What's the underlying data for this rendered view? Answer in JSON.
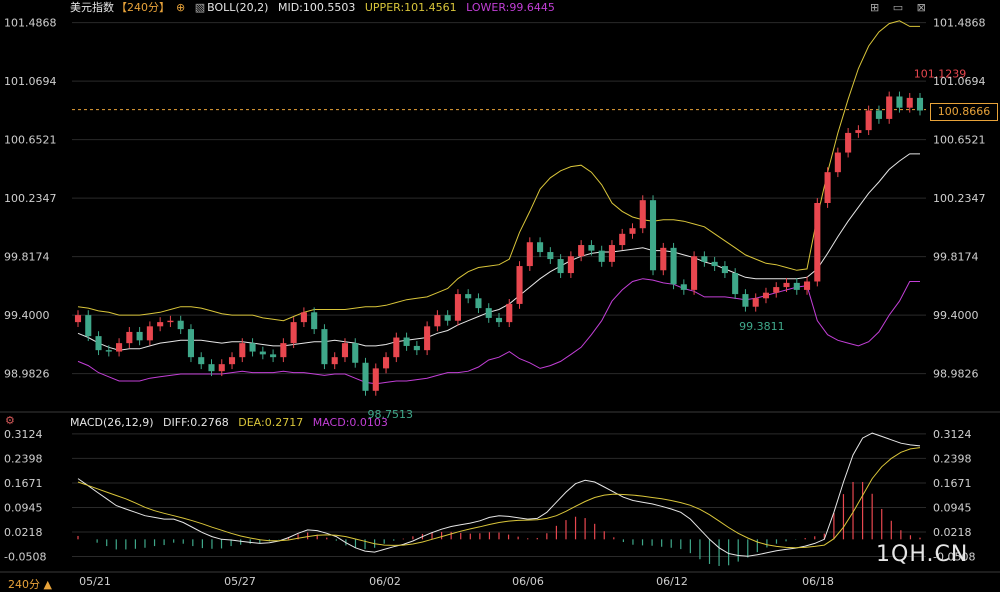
{
  "header": {
    "title": "美元指数",
    "period_label": "【240分】",
    "bull_label": "BOLL(20,2)",
    "mid": "MID:100.5503",
    "upper": "UPPER:101.4561",
    "lower": "LOWER:99.6445"
  },
  "macd_header": {
    "label": "MACD(26,12,9)",
    "diff": "DIFF:0.2768",
    "dea": "DEA:0.2717",
    "macd": "MACD:0.0103"
  },
  "current_price_tag": "100.8666",
  "period_button": "240分",
  "watermark": "1QH.CN",
  "colors": {
    "up": "#e8474f",
    "down": "#3fa88a",
    "mid": "#e6e6e6",
    "upper": "#d9c53a",
    "lower": "#c23fd6",
    "diff": "#e6e6e6",
    "dea": "#d9c53a",
    "grid": "#2a2a2a",
    "axis": "#cfcfcf"
  },
  "chart_data": [
    {
      "type": "candlestick",
      "title": "美元指数 240分",
      "y_ticks": [
        "101.4868",
        "101.0694",
        "100.6521",
        "100.2347",
        "99.8174",
        "99.4000",
        "98.9826"
      ],
      "y_tick_values": [
        101.4868,
        101.0694,
        100.6521,
        100.2347,
        99.8174,
        99.4,
        98.9826
      ],
      "x_ticks": [
        "05/21",
        "05/27",
        "06/02",
        "06/06",
        "06/12",
        "06/18"
      ],
      "annotations": [
        "101.1239",
        "98.7513",
        "99.3811"
      ],
      "last_price": 100.8666,
      "ylim": [
        98.83,
        101.52
      ],
      "candles_close": [
        99.4,
        99.25,
        99.15,
        99.14,
        99.2,
        99.28,
        99.22,
        99.32,
        99.35,
        99.36,
        99.3,
        99.1,
        99.05,
        99.0,
        99.05,
        99.1,
        99.2,
        99.14,
        99.12,
        99.1,
        99.2,
        99.35,
        99.42,
        99.3,
        99.05,
        99.1,
        99.2,
        99.06,
        98.86,
        99.02,
        99.1,
        99.24,
        99.18,
        99.15,
        99.32,
        99.4,
        99.36,
        99.55,
        99.52,
        99.45,
        99.38,
        99.35,
        99.48,
        99.75,
        99.92,
        99.85,
        99.8,
        99.7,
        99.82,
        99.9,
        99.86,
        99.78,
        99.9,
        99.98,
        100.02,
        100.22,
        99.72,
        99.88,
        99.62,
        99.58,
        99.82,
        99.78,
        99.75,
        99.7,
        99.55,
        99.46,
        99.52,
        99.56,
        99.6,
        99.63,
        99.58,
        99.64,
        100.2,
        100.42,
        100.56,
        100.7,
        100.72,
        100.86,
        100.8,
        100.96,
        100.88,
        100.95,
        100.86
      ],
      "mid_band": [
        99.27,
        99.24,
        99.2,
        99.17,
        99.15,
        99.16,
        99.16,
        99.18,
        99.2,
        99.21,
        99.22,
        99.22,
        99.22,
        99.21,
        99.2,
        99.21,
        99.21,
        99.2,
        99.19,
        99.18,
        99.18,
        99.19,
        99.2,
        99.21,
        99.21,
        99.22,
        99.21,
        99.2,
        99.18,
        99.18,
        99.19,
        99.21,
        99.22,
        99.23,
        99.24,
        99.27,
        99.29,
        99.33,
        99.36,
        99.39,
        99.42,
        99.44,
        99.48,
        99.54,
        99.6,
        99.66,
        99.71,
        99.75,
        99.79,
        99.82,
        99.84,
        99.85,
        99.85,
        99.86,
        99.87,
        99.88,
        99.86,
        99.86,
        99.85,
        99.83,
        99.81,
        99.78,
        99.76,
        99.73,
        99.7,
        99.67,
        99.66,
        99.66,
        99.66,
        99.66,
        99.66,
        99.67,
        99.73,
        99.84,
        99.96,
        100.07,
        100.17,
        100.27,
        100.35,
        100.44,
        100.5,
        100.55,
        100.55
      ],
      "upper_band": [
        99.46,
        99.45,
        99.43,
        99.42,
        99.4,
        99.4,
        99.4,
        99.41,
        99.42,
        99.44,
        99.46,
        99.46,
        99.45,
        99.43,
        99.41,
        99.4,
        99.4,
        99.4,
        99.38,
        99.37,
        99.36,
        99.39,
        99.42,
        99.44,
        99.44,
        99.44,
        99.44,
        99.45,
        99.46,
        99.46,
        99.47,
        99.49,
        99.51,
        99.52,
        99.53,
        99.56,
        99.59,
        99.66,
        99.71,
        99.74,
        99.75,
        99.76,
        99.8,
        99.99,
        100.14,
        100.3,
        100.38,
        100.43,
        100.46,
        100.47,
        100.42,
        100.33,
        100.2,
        100.14,
        100.1,
        100.08,
        100.07,
        100.08,
        100.08,
        100.07,
        100.05,
        100.03,
        99.98,
        99.93,
        99.88,
        99.83,
        99.8,
        99.77,
        99.76,
        99.74,
        99.72,
        99.73,
        100.1,
        100.42,
        100.7,
        100.94,
        101.16,
        101.32,
        101.42,
        101.48,
        101.5,
        101.46,
        101.46
      ],
      "lower_band": [
        99.07,
        99.04,
        98.99,
        98.96,
        98.93,
        98.93,
        98.93,
        98.95,
        98.96,
        98.97,
        98.98,
        98.98,
        98.98,
        98.98,
        98.98,
        98.99,
        99.0,
        98.99,
        98.99,
        98.99,
        99.0,
        98.99,
        98.99,
        98.98,
        98.97,
        98.98,
        98.98,
        98.95,
        98.92,
        98.91,
        98.92,
        98.93,
        98.93,
        98.94,
        98.95,
        98.97,
        98.99,
        98.99,
        99.0,
        99.03,
        99.08,
        99.1,
        99.14,
        99.09,
        99.06,
        99.02,
        99.04,
        99.07,
        99.12,
        99.17,
        99.26,
        99.36,
        99.5,
        99.58,
        99.64,
        99.66,
        99.65,
        99.63,
        99.62,
        99.59,
        99.57,
        99.53,
        99.53,
        99.53,
        99.52,
        99.51,
        99.52,
        99.54,
        99.56,
        99.58,
        99.6,
        99.61,
        99.36,
        99.26,
        99.22,
        99.2,
        99.18,
        99.21,
        99.28,
        99.4,
        99.5,
        99.64,
        99.64
      ]
    },
    {
      "type": "bar",
      "title": "MACD(26,12,9)",
      "y_ticks": [
        "0.3124",
        "0.2398",
        "0.1671",
        "0.0945",
        "0.0218",
        "-0.0508"
      ],
      "y_tick_values": [
        0.3124,
        0.2398,
        0.1671,
        0.0945,
        0.0218,
        -0.0508
      ],
      "ylim": [
        -0.085,
        0.33
      ],
      "diff": [
        0.18,
        0.16,
        0.14,
        0.12,
        0.1,
        0.09,
        0.08,
        0.07,
        0.065,
        0.06,
        0.06,
        0.05,
        0.035,
        0.02,
        0.008,
        0.0,
        -0.002,
        -0.006,
        -0.009,
        -0.012,
        -0.01,
        -0.005,
        0.005,
        0.018,
        0.028,
        0.026,
        0.018,
        0.008,
        -0.01,
        -0.025,
        -0.035,
        -0.038,
        -0.03,
        -0.022,
        -0.015,
        -0.005,
        0.008,
        0.02,
        0.03,
        0.038,
        0.043,
        0.048,
        0.055,
        0.065,
        0.07,
        0.068,
        0.064,
        0.06,
        0.062,
        0.08,
        0.11,
        0.14,
        0.165,
        0.175,
        0.17,
        0.155,
        0.14,
        0.125,
        0.115,
        0.11,
        0.105,
        0.098,
        0.09,
        0.08,
        0.06,
        0.03,
        0.0,
        -0.025,
        -0.042,
        -0.048,
        -0.05,
        -0.046,
        -0.04,
        -0.034,
        -0.03,
        -0.026,
        -0.02,
        -0.012,
        0.0,
        0.08,
        0.17,
        0.25,
        0.3,
        0.315,
        0.305,
        0.295,
        0.285,
        0.28,
        0.277
      ],
      "dea": [
        0.17,
        0.16,
        0.15,
        0.14,
        0.13,
        0.12,
        0.108,
        0.095,
        0.085,
        0.077,
        0.07,
        0.063,
        0.055,
        0.046,
        0.036,
        0.027,
        0.018,
        0.01,
        0.004,
        -0.001,
        -0.004,
        -0.004,
        -0.002,
        0.003,
        0.008,
        0.012,
        0.013,
        0.012,
        0.008,
        0.001,
        -0.006,
        -0.013,
        -0.017,
        -0.018,
        -0.017,
        -0.014,
        -0.008,
        0.0,
        0.008,
        0.016,
        0.024,
        0.031,
        0.037,
        0.044,
        0.05,
        0.054,
        0.056,
        0.057,
        0.058,
        0.062,
        0.07,
        0.083,
        0.098,
        0.112,
        0.124,
        0.131,
        0.134,
        0.133,
        0.131,
        0.128,
        0.124,
        0.12,
        0.115,
        0.109,
        0.101,
        0.089,
        0.073,
        0.054,
        0.035,
        0.018,
        0.004,
        -0.008,
        -0.016,
        -0.021,
        -0.024,
        -0.025,
        -0.024,
        -0.021,
        -0.017,
        0.002,
        0.036,
        0.08,
        0.13,
        0.18,
        0.215,
        0.24,
        0.258,
        0.268,
        0.272
      ],
      "macd": [
        0.01,
        0.0,
        -0.01,
        -0.02,
        -0.03,
        -0.03,
        -0.028,
        -0.025,
        -0.02,
        -0.017,
        -0.01,
        -0.013,
        -0.02,
        -0.026,
        -0.028,
        -0.027,
        -0.02,
        -0.016,
        -0.013,
        -0.011,
        -0.006,
        -0.001,
        0.007,
        0.015,
        0.02,
        0.014,
        0.005,
        -0.004,
        -0.018,
        -0.026,
        -0.029,
        -0.025,
        -0.013,
        -0.004,
        0.002,
        0.009,
        0.016,
        0.02,
        0.022,
        0.022,
        0.019,
        0.017,
        0.018,
        0.021,
        0.02,
        0.014,
        0.008,
        0.003,
        0.004,
        0.018,
        0.04,
        0.057,
        0.067,
        0.063,
        0.046,
        0.024,
        0.006,
        -0.008,
        -0.016,
        -0.018,
        -0.019,
        -0.022,
        -0.025,
        -0.029,
        -0.041,
        -0.059,
        -0.073,
        -0.079,
        -0.077,
        -0.066,
        -0.054,
        -0.038,
        -0.024,
        -0.013,
        -0.006,
        -0.001,
        0.004,
        0.009,
        0.017,
        0.078,
        0.134,
        0.17,
        0.17,
        0.135,
        0.09,
        0.055,
        0.027,
        0.012,
        0.005
      ],
      "x_ticks": [
        "05/21",
        "05/27",
        "06/02",
        "06/06",
        "06/12",
        "06/18"
      ]
    }
  ]
}
